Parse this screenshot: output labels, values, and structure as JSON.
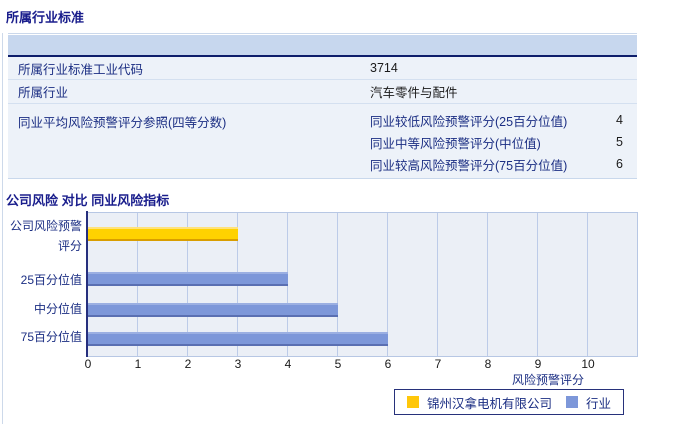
{
  "section1": {
    "title": "所属行业标准",
    "rows": [
      {
        "label": "所属行业标准工业代码",
        "value": "3714"
      },
      {
        "label": "所属行业",
        "value": "汽车零件与配件"
      },
      {
        "label": "同业平均风险预警评分参照(四等分数)",
        "subrows": [
          {
            "label": "同业较低风险预警评分(25百分位值)",
            "value": "4"
          },
          {
            "label": "同业中等风险预警评分(中位值)",
            "value": "5"
          },
          {
            "label": "同业较高风险预警评分(75百分位值)",
            "value": "6"
          }
        ]
      }
    ]
  },
  "section2": {
    "title": "公司风险 对比 同业风险指标"
  },
  "chart_data": {
    "type": "bar",
    "orientation": "horizontal",
    "title": "",
    "categories": [
      "公司风险预警评分",
      "25百分位值",
      "中分位值",
      "75百分位值"
    ],
    "values": [
      3,
      4,
      5,
      6
    ],
    "bar_colors": [
      "#FFD200",
      "#7D97D9",
      "#7D97D9",
      "#7D97D9"
    ],
    "xlabel": "风险预警评分",
    "ylabel": "",
    "xlim": [
      0,
      10
    ],
    "xticks": [
      "0",
      "1",
      "2",
      "3",
      "4",
      "5",
      "6",
      "7",
      "8",
      "9",
      "10"
    ],
    "grid": "vertical",
    "legend_position": "bottom",
    "legend": [
      {
        "label": "锦州汉拿电机有限公司",
        "color": "#FFC70A"
      },
      {
        "label": "行业",
        "color": "#7D97D9"
      }
    ]
  }
}
